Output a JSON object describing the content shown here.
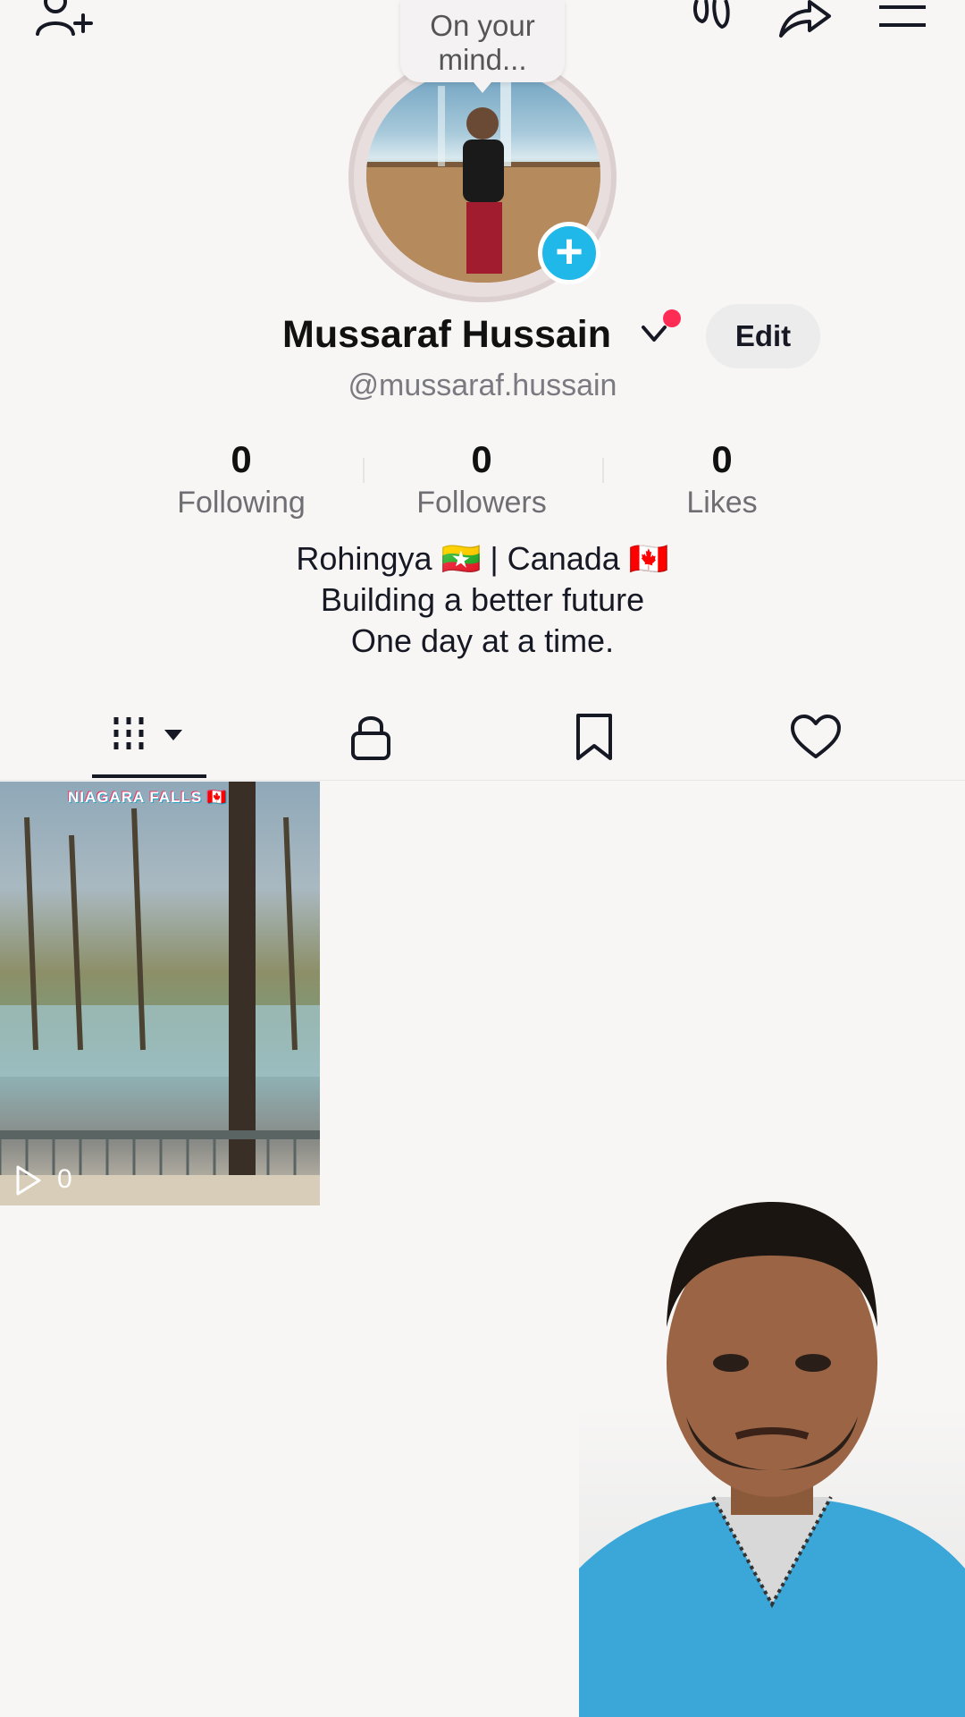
{
  "bubble": {
    "line1": "On your",
    "line2": "mind..."
  },
  "profile": {
    "name": "Mussaraf Hussain",
    "handle": "@mussaraf.hussain",
    "edit_label": "Edit"
  },
  "stats": [
    {
      "value": "0",
      "label": "Following"
    },
    {
      "value": "0",
      "label": "Followers"
    },
    {
      "value": "0",
      "label": "Likes"
    }
  ],
  "bio": {
    "line1": "Rohingya 🇲🇲 | Canada 🇨🇦",
    "line2": "Building a better future",
    "line3": "One day at a time."
  },
  "tabs": [
    {
      "icon": "grid-videos-icon",
      "selected": true
    },
    {
      "icon": "lock-icon",
      "selected": false
    },
    {
      "icon": "bookmark-icon",
      "selected": false
    },
    {
      "icon": "heart-icon",
      "selected": false
    }
  ],
  "videos": [
    {
      "caption": "NIAGARA FALLS 🇨🇦",
      "views": "0"
    }
  ],
  "colors": {
    "accent_blue": "#20b8e8",
    "notify_red": "#fe2c55",
    "text_dark": "#161823",
    "text_gray": "#7a7a80"
  }
}
